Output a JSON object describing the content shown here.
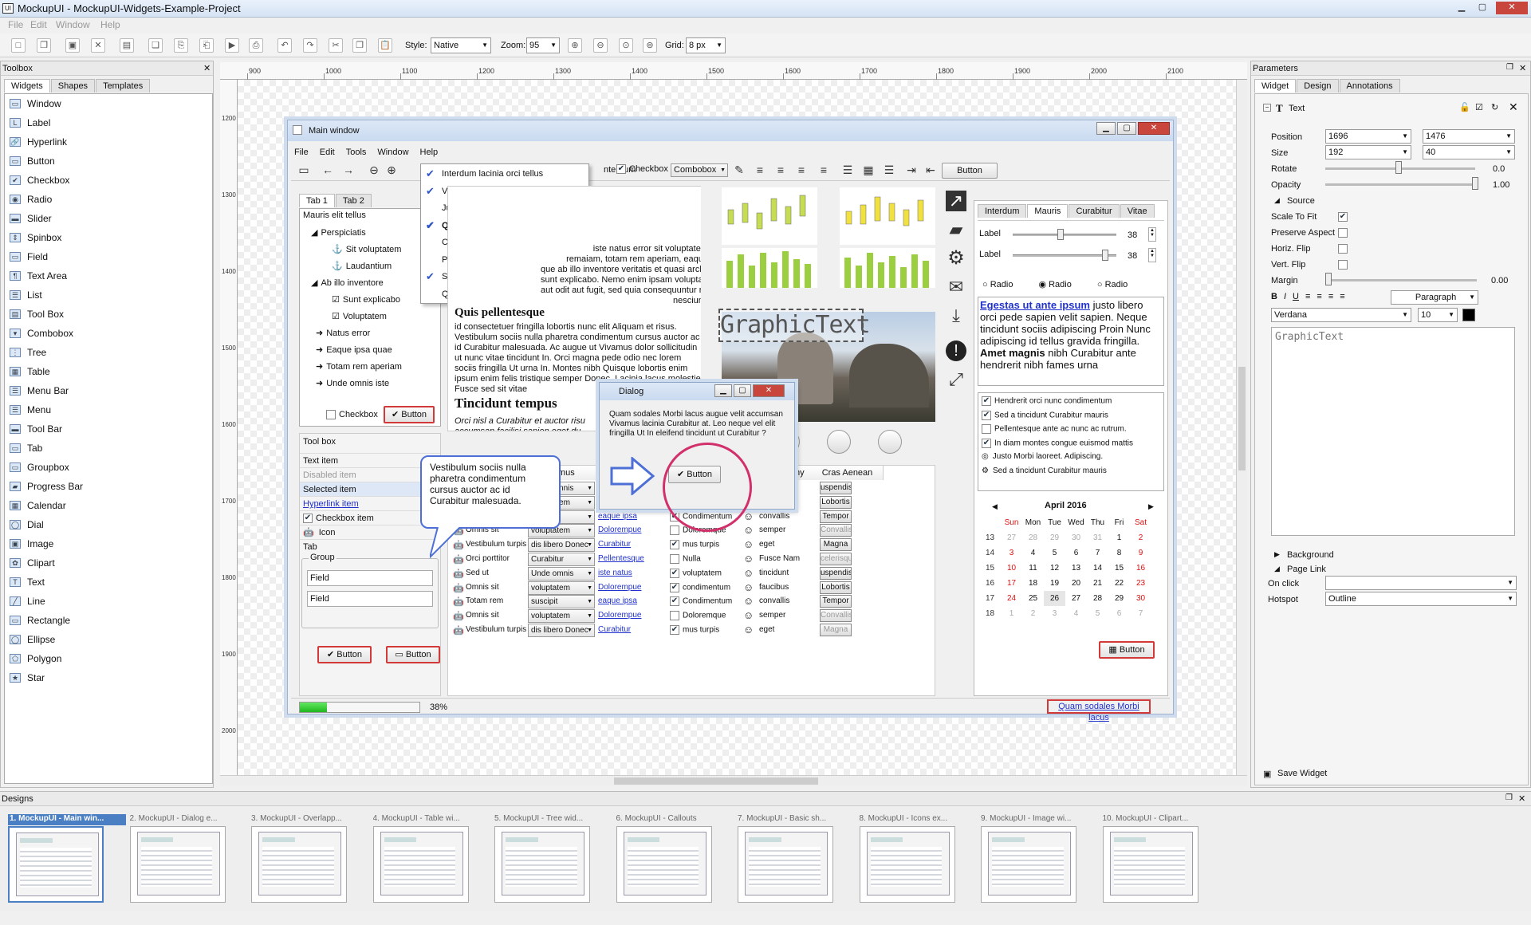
{
  "app": {
    "title": "MockupUI - MockupUI-Widgets-Example-Project",
    "menu": [
      "File",
      "Edit",
      "Window",
      "Help"
    ]
  },
  "toolbar": {
    "style_label": "Style:",
    "style_value": "Native",
    "zoom_label": "Zoom:",
    "zoom_value": "95",
    "grid_label": "Grid:",
    "grid_value": "8 px"
  },
  "toolbox": {
    "title": "Toolbox",
    "tabs": [
      "Widgets",
      "Shapes",
      "Templates"
    ],
    "items": [
      "Window",
      "Label",
      "Hyperlink",
      "Button",
      "Checkbox",
      "Radio",
      "Slider",
      "Spinbox",
      "Field",
      "Text Area",
      "List",
      "Tool Box",
      "Combobox",
      "Tree",
      "Table",
      "Menu Bar",
      "Menu",
      "Tool Bar",
      "Tab",
      "Groupbox",
      "Progress Bar",
      "Calendar",
      "Dial",
      "Image",
      "Clipart",
      "Text",
      "Line",
      "Rectangle",
      "Ellipse",
      "Polygon",
      "Star"
    ]
  },
  "rulers": {
    "h": [
      "900",
      "1000",
      "1100",
      "1200",
      "1300",
      "1400",
      "1500",
      "1600",
      "1700",
      "1800",
      "1900",
      "2000",
      "2100"
    ],
    "v": [
      "1200",
      "1300",
      "1400",
      "1500",
      "1600",
      "1700",
      "1800",
      "1900",
      "2000"
    ]
  },
  "mockwin": {
    "title": "Main window",
    "menu": [
      "File",
      "Edit",
      "Tools",
      "Window",
      "Help"
    ],
    "toolbar_tail": {
      "checkbox_label": "Checkbox",
      "combo": "Combobox",
      "button": "Button",
      "clipped": "nterdum"
    },
    "dropdown": [
      {
        "t": "Interdum lacinia orci tellus",
        "c": true
      },
      {
        "t": "Velit et Sed adipiscing cursus",
        "c": true
      },
      {
        "t": "Justo Pellentesque nunc id aliquet",
        "c": false
      },
      {
        "t": "Quisque laoreet vitae.",
        "c": true
      },
      {
        "t": "Curabitur id sociis interdum",
        "c": false
      },
      {
        "t": "Proin eget dolor semper Nullam",
        "c": false
      },
      {
        "t": "Sapien hendrerit et consectetuer",
        "c": true
      },
      {
        "t": "Quisque vitae tempus.",
        "c": false
      }
    ],
    "tabs": [
      "Tab 1",
      "Tab 2"
    ],
    "tree": [
      "Mauris elit tellus",
      "Perspiciatis",
      "Sit voluptatem",
      "Laudantium",
      "Ab illo inventore",
      "Sunt explicabo",
      "Voluptatem",
      "Natus error",
      "Eaque ipsa quae",
      "Totam rem aperiam",
      "Unde omnis iste"
    ],
    "tree_checkbox": "Checkbox",
    "tree_button": "Button",
    "toolbox": {
      "title": "Tool box",
      "items": [
        "Text item",
        "Disabled item",
        "Selected item",
        "Hyperlink item",
        "Checkbox item",
        "Icon",
        "Tab"
      ]
    },
    "group": {
      "title": "Group",
      "fields": [
        "Field",
        "Field"
      ],
      "buttons": [
        "Button",
        "Button"
      ]
    },
    "text": {
      "clipped_para": "iste natus error sit voluptatem\nremaiam, totam rem aperiam, eaque\nque ab illo inventore veritatis et quasi architecto beatae vitae\nsunt explicabo. Nemo enim ipsam voluptatem quia voluptas sit\naut odit aut fugit, sed quia consequuntur magni dolores\nnesciunt.",
      "h1": "Quis pellentesque",
      "p1": "id consectetuer fringilla lobortis nunc elit Aliquam et risus. Vestibulum sociis nulla pharetra condimentum cursus auctor ac id Curabitur malesuada. Ac augue ut Vivamus dolor sollicitudin ut nunc vitae tincidunt In. Orci magna pede odio nec lorem sociis fringilla Ut urna In. Montes nibh Quisque lobortis enim ipsum enim felis tristique semper Donec. Lacinia lacus molestie Fusce sed sit vitae",
      "h2": "Tincidunt tempus",
      "p2": "Orci nisl a Curabitur et auctor risu\naccumsan facilisi sapien eget du"
    },
    "callout": "Vestibulum sociis nulla pharetra condimentum cursus auctor ac id Curabitur malesuada.",
    "dialog": {
      "title": "Dialog",
      "text": "Quam sodales Morbi lacus augue velit accumsan Vivamus lacinia Curabitur at. Leo neque vel elit fringilla Ut In eleifend tincidunt ut Curabitur ?",
      "button": "Button"
    },
    "graphic_text": "GraphicText",
    "table_headers": [
      "vamus",
      "Ut nonummy",
      "Cras Aenean"
    ],
    "table_rows": [
      [
        "",
        "Unde omnis",
        "",
        "",
        "",
        "uspendiss"
      ],
      [
        "",
        "voluptatem",
        "Dolorempue",
        "condimentum",
        "faucibus",
        "Lobortis"
      ],
      [
        "Totam rem",
        "suscipit",
        "eaque ipsa",
        "Condimentum",
        "convallis",
        "Tempor"
      ],
      [
        "Omnis sit",
        "voluptatem",
        "Dolorempue",
        "Doloremque",
        "semper",
        "Convallis"
      ],
      [
        "Vestibulum turpis",
        "dis libero Donec",
        "Curabitur",
        "mus turpis",
        "eget",
        "Magna"
      ],
      [
        "Orci porttitor",
        "Curabitur",
        "Pellentesque",
        "Nulla",
        "Fusce Nam",
        "celerisque"
      ],
      [
        "Sed ut",
        "Unde omnis",
        "iste natus",
        "voluptatem",
        "tincidunt",
        "uspendiss"
      ],
      [
        "Omnis sit",
        "voluptatem",
        "Dolorempue",
        "condimentum",
        "faucibus",
        "Lobortis"
      ],
      [
        "Totam rem",
        "suscipit",
        "eaque ipsa",
        "Condimentum",
        "convallis",
        "Tempor"
      ],
      [
        "Omnis sit",
        "voluptatem",
        "Dolorempue",
        "Doloremque",
        "semper",
        "Convallis"
      ],
      [
        "Vestibulum turpis",
        "dis libero Donec",
        "Curabitur",
        "mus turpis",
        "eget",
        "Magna"
      ]
    ],
    "table_row0_col4": "tincidunt",
    "right_tabs": [
      "Interdum",
      "Mauris",
      "Curabitur",
      "Vitae"
    ],
    "sliders": [
      {
        "label": "Label",
        "value": "38"
      },
      {
        "label": "Label",
        "value": "38"
      }
    ],
    "radios": [
      "Radio",
      "Radio",
      "Radio"
    ],
    "richtext": {
      "link": "Egestas ut ante ipsum",
      "t1": " justo libero orci pede sapien velit sapien. Neque tincidunt sociis adipiscing Proin Nunc adipiscing id tellus gravida fringilla. ",
      "b1": "Amet magnis",
      "t2": " nibh Curabitur ante hendrerit nibh fames urna"
    },
    "checklist": [
      {
        "t": "Hendrerit orci nunc condimentum",
        "c": true
      },
      {
        "t": "Sed a tincidunt Curabitur mauris",
        "c": true
      },
      {
        "t": "Pellentesque ante ac nunc ac rutrum.",
        "c": false
      },
      {
        "t": "In diam montes congue euismod mattis",
        "c": true
      },
      {
        "t": "Justo Morbi laoreet. Adipiscing.",
        "c": false
      },
      {
        "t": "Sed a tincidunt Curabitur mauris",
        "c": false
      }
    ],
    "calendar": {
      "month": "April 2016",
      "days": [
        "Sun",
        "Mon",
        "Tue",
        "Wed",
        "Thu",
        "Fri",
        "Sat"
      ],
      "weeks": [
        [
          "13",
          "27",
          "28",
          "29",
          "30",
          "31",
          "1",
          "2"
        ],
        [
          "14",
          "3",
          "4",
          "5",
          "6",
          "7",
          "8",
          "9"
        ],
        [
          "15",
          "10",
          "11",
          "12",
          "13",
          "14",
          "15",
          "16"
        ],
        [
          "16",
          "17",
          "18",
          "19",
          "20",
          "21",
          "22",
          "23"
        ],
        [
          "17",
          "24",
          "25",
          "26",
          "27",
          "28",
          "29",
          "30"
        ],
        [
          "18",
          "1",
          "2",
          "3",
          "4",
          "5",
          "6",
          "7"
        ]
      ],
      "button": "Button"
    },
    "progress": {
      "value": 38,
      "label": "38%"
    },
    "status_link": "Quam sodales Morbi lacus",
    "clipped_up": "up"
  },
  "params": {
    "title": "Parameters",
    "tabs": [
      "Widget",
      "Design",
      "Annotations"
    ],
    "widget_title": "Text",
    "position_label": "Position",
    "position_x": "1696",
    "position_y": "1476",
    "size_label": "Size",
    "size_w": "192",
    "size_h": "40",
    "rotate_label": "Rotate",
    "rotate_value": "0.0",
    "opacity_label": "Opacity",
    "opacity_value": "1.00",
    "source_label": "Source",
    "scale_label": "Scale To Fit",
    "preserve_label": "Preserve Aspect",
    "hflip_label": "Horiz. Flip",
    "vflip_label": "Vert. Flip",
    "margin_label": "Margin",
    "margin_value": "0.00",
    "para_value": "Paragraph",
    "font_value": "Verdana",
    "fontsize_value": "10",
    "text_value": "GraphicText",
    "background_label": "Background",
    "pagelink_label": "Page Link",
    "onclick_label": "On click",
    "onclick_value": "",
    "hotspot_label": "Hotspot",
    "hotspot_value": "Outline",
    "save_label": "Save Widget"
  },
  "designs": {
    "title": "Designs",
    "items": [
      "1. MockupUI - Main win...",
      "2. MockupUI - Dialog e...",
      "3. MockupUI - Overlapp...",
      "4. MockupUI - Table wi...",
      "5. MockupUI - Tree wid...",
      "6. MockupUI - Callouts",
      "7. MockupUI - Basic sh...",
      "8. MockupUI - Icons ex...",
      "9. MockupUI - Image wi...",
      "10. MockupUI - Clipart..."
    ]
  }
}
